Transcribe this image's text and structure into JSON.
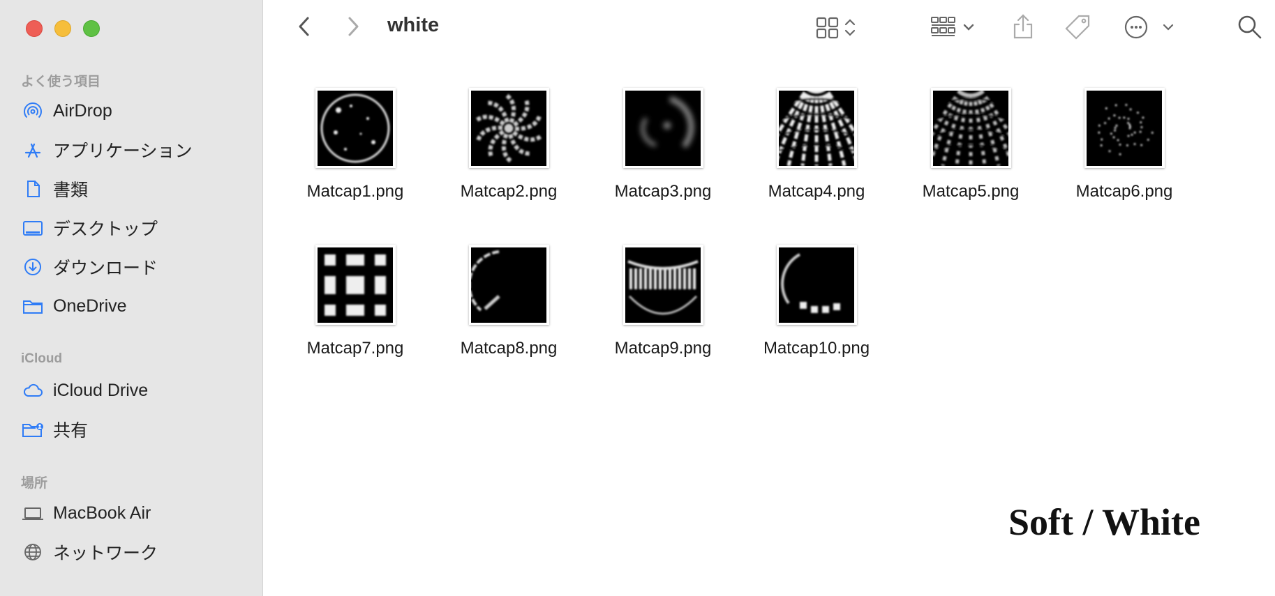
{
  "window": {
    "traffic_lights": [
      "close",
      "minimize",
      "zoom"
    ]
  },
  "sidebar": {
    "sections": [
      {
        "header": "よく使う項目",
        "items": [
          {
            "label": "AirDrop",
            "icon": "airdrop-icon"
          },
          {
            "label": "アプリケーション",
            "icon": "applications-icon"
          },
          {
            "label": "書類",
            "icon": "document-icon"
          },
          {
            "label": "デスクトップ",
            "icon": "desktop-icon"
          },
          {
            "label": "ダウンロード",
            "icon": "download-icon"
          },
          {
            "label": "OneDrive",
            "icon": "folder-icon"
          }
        ]
      },
      {
        "header": "iCloud",
        "items": [
          {
            "label": "iCloud Drive",
            "icon": "cloud-icon"
          },
          {
            "label": "共有",
            "icon": "shared-folder-icon"
          }
        ]
      },
      {
        "header": "場所",
        "items": [
          {
            "label": "MacBook Air",
            "icon": "laptop-icon"
          },
          {
            "label": "ネットワーク",
            "icon": "globe-icon"
          }
        ]
      }
    ]
  },
  "toolbar": {
    "title": "white",
    "buttons": [
      "back-icon",
      "forward-icon",
      "icon-view-icon",
      "group-icon",
      "share-icon",
      "tag-icon",
      "more-icon",
      "search-icon"
    ]
  },
  "files": [
    {
      "name": "Matcap1.png",
      "pattern": "ring"
    },
    {
      "name": "Matcap2.png",
      "pattern": "swirl"
    },
    {
      "name": "Matcap3.png",
      "pattern": "blur"
    },
    {
      "name": "Matcap4.png",
      "pattern": "dome"
    },
    {
      "name": "Matcap5.png",
      "pattern": "dome-dim"
    },
    {
      "name": "Matcap6.png",
      "pattern": "sparkle"
    },
    {
      "name": "Matcap7.png",
      "pattern": "grid"
    },
    {
      "name": "Matcap8.png",
      "pattern": "edge"
    },
    {
      "name": "Matcap9.png",
      "pattern": "bands"
    },
    {
      "name": "Matcap10.png",
      "pattern": "arc"
    }
  ],
  "watermark": "Soft / White",
  "colors": {
    "accent": "#2f7cf6",
    "sidebar_bg": "#e6e6e6",
    "close": "#ee5e56",
    "minimize": "#f6be3b",
    "zoom": "#5fc144"
  }
}
